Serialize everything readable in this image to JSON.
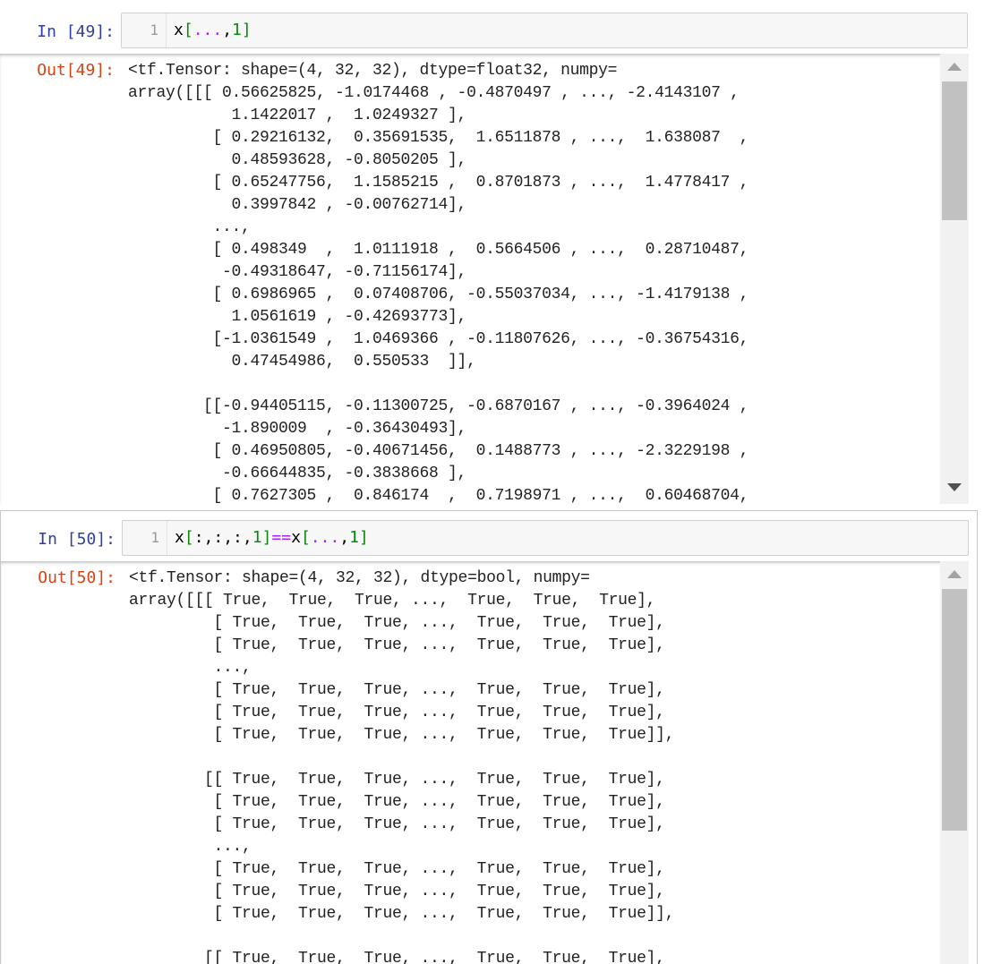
{
  "cells": [
    {
      "in_prompt": "In  [49]:",
      "line_number": "1",
      "code": {
        "var": "x",
        "open": "[",
        "dots": "...",
        "sep": ",",
        "idx": "1",
        "close": "]"
      },
      "out_prompt": "Out[49]:",
      "output_lines": [
        "<tf.Tensor: shape=(4, 32, 32), dtype=float32, numpy=",
        "array([[[ 0.56625825, -1.0174468 , -0.4870497 , ..., -2.4143107 ,",
        "           1.1422017 ,  1.0249327 ],",
        "         [ 0.29216132,  0.35691535,  1.6511878 , ...,  1.638087  ,",
        "           0.48593628, -0.8050205 ],",
        "         [ 0.65247756,  1.1585215 ,  0.8701873 , ...,  1.4778417 ,",
        "           0.3997842 , -0.00762714],",
        "         ...,",
        "         [ 0.498349  ,  1.0111918 ,  0.5664506 , ...,  0.28710487,",
        "          -0.49318647, -0.71156174],",
        "         [ 0.6986965 ,  0.07408706, -0.55037034, ..., -1.4179138 ,",
        "           1.0561619 , -0.42693773],",
        "         [-1.0361549 ,  1.0469366 , -0.11807626, ..., -0.36754316,",
        "           0.47454986,  0.550533  ]],",
        "",
        "        [[-0.94405115, -0.11300725, -0.6870167 , ..., -0.3964024 ,",
        "          -1.890009  , -0.36430493],",
        "         [ 0.46950805, -0.40671456,  0.1488773 , ..., -2.3229198 ,",
        "          -0.66644835, -0.3838668 ],",
        "         [ 0.7627305 ,  0.846174  ,  0.7198971 , ...,  0.60468704,"
      ]
    },
    {
      "in_prompt": "In  [50]:",
      "line_number": "1",
      "code": {
        "var": "x",
        "open": "[",
        "slices": ":,:,:,",
        "idx": "1",
        "close": "]",
        "op": "==",
        "var2": "x",
        "open2": "[",
        "dots": "...",
        "sep": ",",
        "idx2": "1",
        "close2": "]"
      },
      "out_prompt": "Out[50]:",
      "output_lines": [
        "<tf.Tensor: shape=(4, 32, 32), dtype=bool, numpy=",
        "array([[[ True,  True,  True, ...,  True,  True,  True],",
        "         [ True,  True,  True, ...,  True,  True,  True],",
        "         [ True,  True,  True, ...,  True,  True,  True],",
        "         ...,",
        "         [ True,  True,  True, ...,  True,  True,  True],",
        "         [ True,  True,  True, ...,  True,  True,  True],",
        "         [ True,  True,  True, ...,  True,  True,  True]],",
        "",
        "        [[ True,  True,  True, ...,  True,  True,  True],",
        "         [ True,  True,  True, ...,  True,  True,  True],",
        "         [ True,  True,  True, ...,  True,  True,  True],",
        "         ...,",
        "         [ True,  True,  True, ...,  True,  True,  True],",
        "         [ True,  True,  True, ...,  True,  True,  True],",
        "         [ True,  True,  True, ...,  True,  True,  True]],",
        "",
        "        [[ True,  True,  True, ...,  True,  True,  True],"
      ]
    }
  ]
}
